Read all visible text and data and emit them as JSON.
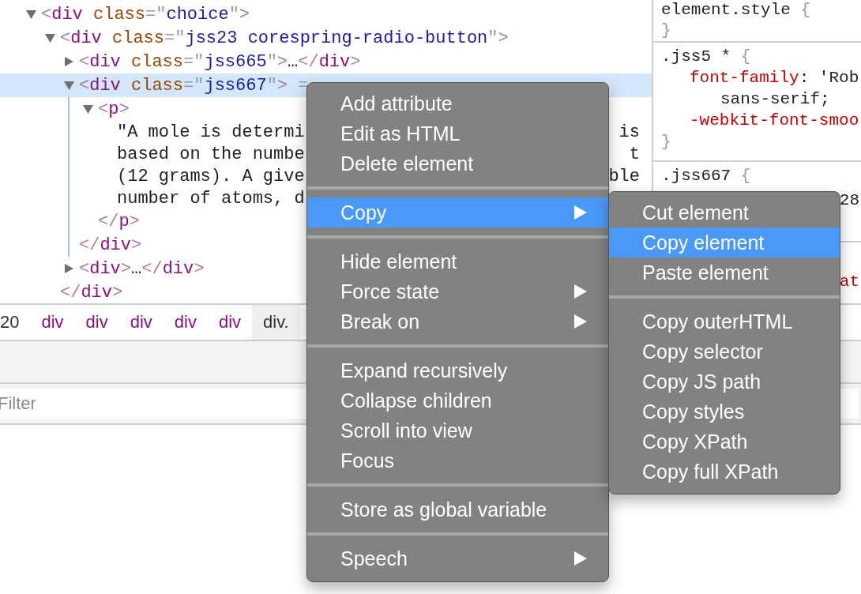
{
  "dom_tree": [
    {
      "kind": "element",
      "expanded": true,
      "selected": false,
      "tokens": [
        {
          "kind": "bracket",
          "text": "<"
        },
        {
          "kind": "tag",
          "text": "div"
        },
        {
          "kind": "attr",
          "text": " class"
        },
        {
          "kind": "eq",
          "text": "=\""
        },
        {
          "kind": "value",
          "text": "choice"
        },
        {
          "kind": "eq",
          "text": "\""
        },
        {
          "kind": "bracket",
          "text": ">"
        }
      ],
      "children": [
        {
          "kind": "element",
          "expanded": true,
          "selected": false,
          "tokens": [
            {
              "kind": "bracket",
              "text": "<"
            },
            {
              "kind": "tag",
              "text": "div"
            },
            {
              "kind": "attr",
              "text": " class"
            },
            {
              "kind": "eq",
              "text": "=\""
            },
            {
              "kind": "value",
              "text": "jss23 corespring-radio-button"
            },
            {
              "kind": "eq",
              "text": "\""
            },
            {
              "kind": "bracket",
              "text": ">"
            }
          ],
          "children": [
            {
              "kind": "element",
              "expanded": false,
              "selected": false,
              "tokens": [
                {
                  "kind": "bracket",
                  "text": "<"
                },
                {
                  "kind": "tag",
                  "text": "div"
                },
                {
                  "kind": "attr",
                  "text": " class"
                },
                {
                  "kind": "eq",
                  "text": "=\""
                },
                {
                  "kind": "value",
                  "text": "jss665"
                },
                {
                  "kind": "eq",
                  "text": "\""
                },
                {
                  "kind": "bracket",
                  "text": ">"
                },
                {
                  "kind": "ellipsis",
                  "text": "…"
                },
                {
                  "kind": "bracket",
                  "text": "</"
                },
                {
                  "kind": "tag",
                  "text": "div"
                },
                {
                  "kind": "bracket",
                  "text": ">"
                }
              ]
            },
            {
              "kind": "element",
              "expanded": true,
              "selected": true,
              "tokens": [
                {
                  "kind": "bracket",
                  "text": "<"
                },
                {
                  "kind": "tag",
                  "text": "div"
                },
                {
                  "kind": "attr",
                  "text": " class"
                },
                {
                  "kind": "eq",
                  "text": "=\""
                },
                {
                  "kind": "value",
                  "text": "jss667"
                },
                {
                  "kind": "eq",
                  "text": "\""
                },
                {
                  "kind": "bracket",
                  "text": ">"
                },
                {
                  "kind": "marker",
                  "text": " ="
                }
              ],
              "children": [
                {
                  "kind": "element",
                  "expanded": true,
                  "selected": false,
                  "tokens": [
                    {
                      "kind": "bracket",
                      "text": "<"
                    },
                    {
                      "kind": "tag",
                      "text": "p"
                    },
                    {
                      "kind": "bracket",
                      "text": ">"
                    }
                  ],
                  "children": [
                    {
                      "kind": "text",
                      "text": "\"A mole is determi",
                      "tail": "is"
                    },
                    {
                      "kind": "text",
                      "text": "based on the numbe",
                      "tail": "t"
                    },
                    {
                      "kind": "text",
                      "text": "(12 grams). A give",
                      "tail": "ble"
                    },
                    {
                      "kind": "text",
                      "text": "number of atoms, d"
                    }
                  ],
                  "closing": [
                    {
                      "kind": "bracket",
                      "text": "</"
                    },
                    {
                      "kind": "tag",
                      "text": "p"
                    },
                    {
                      "kind": "bracket",
                      "text": ">"
                    }
                  ]
                }
              ],
              "closing": [
                {
                  "kind": "bracket",
                  "text": "</"
                },
                {
                  "kind": "tag",
                  "text": "div"
                },
                {
                  "kind": "bracket",
                  "text": ">"
                }
              ]
            },
            {
              "kind": "element",
              "expanded": false,
              "selected": false,
              "tokens": [
                {
                  "kind": "bracket",
                  "text": "<"
                },
                {
                  "kind": "tag",
                  "text": "div"
                },
                {
                  "kind": "bracket",
                  "text": ">"
                },
                {
                  "kind": "ellipsis",
                  "text": "…"
                },
                {
                  "kind": "bracket",
                  "text": "</"
                },
                {
                  "kind": "tag",
                  "text": "div"
                },
                {
                  "kind": "bracket",
                  "text": ">"
                }
              ]
            }
          ],
          "closing": [
            {
              "kind": "bracket",
              "text": "</"
            },
            {
              "kind": "tag",
              "text": "div"
            },
            {
              "kind": "bracket",
              "text": ">"
            }
          ]
        }
      ]
    }
  ],
  "styles_panel": {
    "sections": [
      {
        "lines": [
          {
            "kind": "selector",
            "tokens": [
              {
                "kind": "selector",
                "text": "element.style"
              },
              {
                "kind": "brace",
                "text": " {"
              }
            ]
          },
          {
            "kind": "end",
            "tokens": [
              {
                "kind": "brace",
                "text": "}"
              }
            ]
          }
        ]
      },
      {
        "lines": [
          {
            "kind": "selector",
            "tokens": [
              {
                "kind": "selector",
                "text": ".jss5 * "
              },
              {
                "kind": "brace",
                "text": "{"
              }
            ]
          },
          {
            "kind": "declaration",
            "tokens": [
              {
                "kind": "prop",
                "text": "font-family"
              },
              {
                "kind": "punct",
                "text": ": 'Rob"
              }
            ]
          },
          {
            "kind": "continuation",
            "tokens": [
              {
                "kind": "punct",
                "text": "sans-serif;"
              }
            ]
          },
          {
            "kind": "declaration",
            "tokens": [
              {
                "kind": "prop",
                "text": "-webkit-font-smoo"
              }
            ]
          },
          {
            "kind": "end",
            "tokens": [
              {
                "kind": "brace",
                "text": "}"
              }
            ]
          }
        ]
      },
      {
        "lines": [
          {
            "kind": "selector",
            "tokens": [
              {
                "kind": "selector",
                "text": ".jss667 "
              },
              {
                "kind": "brace",
                "text": "{"
              }
            ]
          },
          {
            "kind": "tail",
            "tokens": [
              {
                "kind": "punct",
                "text": "28"
              }
            ]
          }
        ]
      },
      {
        "lines": [
          {
            "kind": "tail",
            "tokens": [
              {
                "kind": "prop",
                "text": "at"
              }
            ]
          }
        ]
      }
    ]
  },
  "breadcrumbs": [
    {
      "kind": "text",
      "label": "20",
      "selected": false
    },
    {
      "kind": "tag",
      "label": "div",
      "selected": false
    },
    {
      "kind": "tag",
      "label": "div",
      "selected": false
    },
    {
      "kind": "tag",
      "label": "div",
      "selected": false
    },
    {
      "kind": "tag",
      "label": "div",
      "selected": false
    },
    {
      "kind": "tag",
      "label": "div",
      "selected": false
    },
    {
      "kind": "tag",
      "label": "div.",
      "selected": true
    }
  ],
  "filter": {
    "placeholder": "Filter"
  },
  "context_menu": {
    "items": [
      {
        "kind": "item",
        "label": "Add attribute",
        "has_submenu": false,
        "selected": false
      },
      {
        "kind": "item",
        "label": "Edit as HTML",
        "has_submenu": false,
        "selected": false
      },
      {
        "kind": "item",
        "label": "Delete element",
        "has_submenu": false,
        "selected": false
      },
      {
        "kind": "separator"
      },
      {
        "kind": "item",
        "label": "Copy",
        "has_submenu": true,
        "selected": true
      },
      {
        "kind": "separator"
      },
      {
        "kind": "item",
        "label": "Hide element",
        "has_submenu": false,
        "selected": false
      },
      {
        "kind": "item",
        "label": "Force state",
        "has_submenu": true,
        "selected": false
      },
      {
        "kind": "item",
        "label": "Break on",
        "has_submenu": true,
        "selected": false
      },
      {
        "kind": "separator"
      },
      {
        "kind": "item",
        "label": "Expand recursively",
        "has_submenu": false,
        "selected": false
      },
      {
        "kind": "item",
        "label": "Collapse children",
        "has_submenu": false,
        "selected": false
      },
      {
        "kind": "item",
        "label": "Scroll into view",
        "has_submenu": false,
        "selected": false
      },
      {
        "kind": "item",
        "label": "Focus",
        "has_submenu": false,
        "selected": false
      },
      {
        "kind": "separator"
      },
      {
        "kind": "item",
        "label": "Store as global variable",
        "has_submenu": false,
        "selected": false
      },
      {
        "kind": "separator"
      },
      {
        "kind": "item",
        "label": "Speech",
        "has_submenu": true,
        "selected": false
      }
    ]
  },
  "submenu": {
    "items": [
      {
        "kind": "item",
        "label": "Cut element",
        "has_submenu": false,
        "selected": false
      },
      {
        "kind": "item",
        "label": "Copy element",
        "has_submenu": false,
        "selected": true
      },
      {
        "kind": "item",
        "label": "Paste element",
        "has_submenu": false,
        "selected": false
      },
      {
        "kind": "separator"
      },
      {
        "kind": "item",
        "label": "Copy outerHTML",
        "has_submenu": false,
        "selected": false
      },
      {
        "kind": "item",
        "label": "Copy selector",
        "has_submenu": false,
        "selected": false
      },
      {
        "kind": "item",
        "label": "Copy JS path",
        "has_submenu": false,
        "selected": false
      },
      {
        "kind": "item",
        "label": "Copy styles",
        "has_submenu": false,
        "selected": false
      },
      {
        "kind": "item",
        "label": "Copy XPath",
        "has_submenu": false,
        "selected": false
      },
      {
        "kind": "item",
        "label": "Copy full XPath",
        "has_submenu": false,
        "selected": false
      }
    ]
  }
}
